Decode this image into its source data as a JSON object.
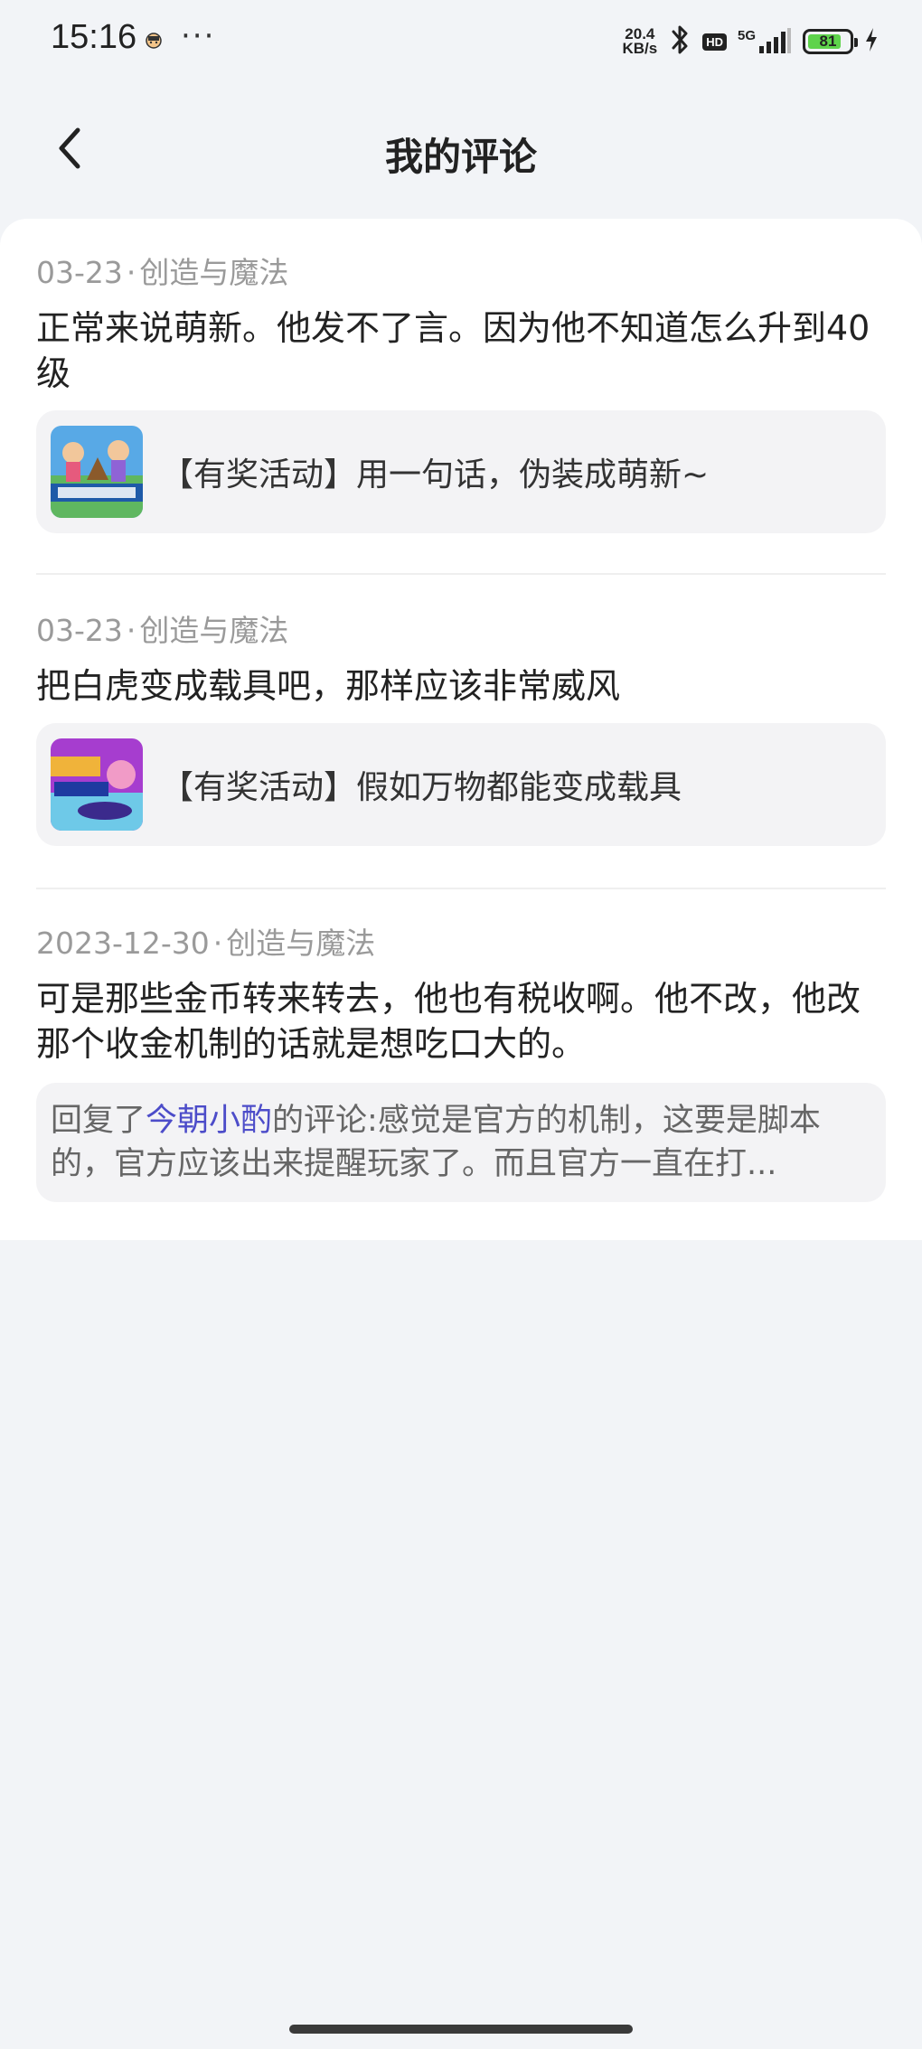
{
  "status_bar": {
    "time": "15:16",
    "dots": "···",
    "net_speed_value": "20.4",
    "net_speed_unit": "KB/s",
    "hd": "HD",
    "network": "5G",
    "battery": "81",
    "battery_level": 0.81,
    "battery_color": "#5ed34b"
  },
  "header": {
    "title": "我的评论"
  },
  "comments": [
    {
      "date": "03-23",
      "dot": "·",
      "game": "创造与魔法",
      "text": "正常来说萌新。他发不了言。因为他不知道怎么升到40级",
      "ref_title": "【有奖活动】用一句话，伪装成萌新~"
    },
    {
      "date": "03-23",
      "dot": "·",
      "game": "创造与魔法",
      "text": "把白虎变成载具吧，那样应该非常威风",
      "ref_title": "【有奖活动】假如万物都能变成载具"
    },
    {
      "date": "2023-12-30",
      "dot": "·",
      "game": "创造与魔法",
      "text": "可是那些金币转来转去，他也有税收啊。他不改，他改那个收金机制的话就是想吃口大的。",
      "reply_prefix": "回复了",
      "reply_user": "今朝小酌",
      "reply_text": "的评论:感觉是官方的机制，这要是脚本的，官方应该出来提醒玩家了。而且官方一直在打..."
    }
  ],
  "colors": {
    "background": "#f2f4f7",
    "card": "#ffffff",
    "link": "#4c4cc9",
    "meta": "#9a9a9a"
  }
}
